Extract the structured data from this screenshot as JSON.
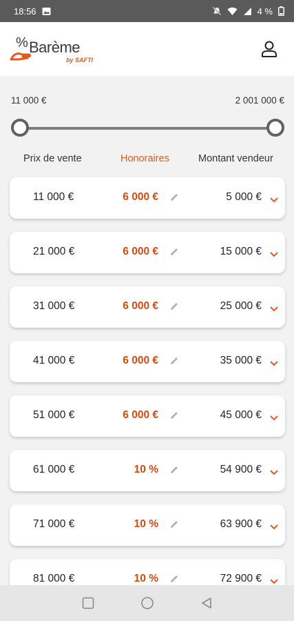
{
  "status_bar": {
    "time": "18:56",
    "battery": "4 %",
    "icons": [
      "image-icon",
      "mute-icon",
      "wifi-icon",
      "signal-icon",
      "battery-icon"
    ]
  },
  "header": {
    "logo_text": "Barème",
    "logo_sub": "by SAFTI",
    "logo_mark": "%",
    "profile_icon": "user-icon"
  },
  "range": {
    "min_label": "11 000 €",
    "max_label": "2 001 000 €",
    "min_position": 0,
    "max_position": 1
  },
  "columns": {
    "price": "Prix de vente",
    "fees": "Honoraires",
    "seller": "Montant vendeur"
  },
  "rows": [
    {
      "price": "11 000 €",
      "fee": "6 000 €",
      "seller": "5 000 €"
    },
    {
      "price": "21 000 €",
      "fee": "6 000 €",
      "seller": "15 000 €"
    },
    {
      "price": "31 000 €",
      "fee": "6 000 €",
      "seller": "25 000 €"
    },
    {
      "price": "41 000 €",
      "fee": "6 000 €",
      "seller": "35 000 €"
    },
    {
      "price": "51 000 €",
      "fee": "6 000 €",
      "seller": "45 000 €"
    },
    {
      "price": "61 000 €",
      "fee": "10 %",
      "seller": "54 900 €"
    },
    {
      "price": "71 000 €",
      "fee": "10 %",
      "seller": "63 900 €"
    },
    {
      "price": "81 000 €",
      "fee": "10 %",
      "seller": "72 900 €"
    }
  ],
  "colors": {
    "accent": "#e8581c",
    "fee_text": "#d64a10",
    "status_bar": "#5a5a5a"
  }
}
